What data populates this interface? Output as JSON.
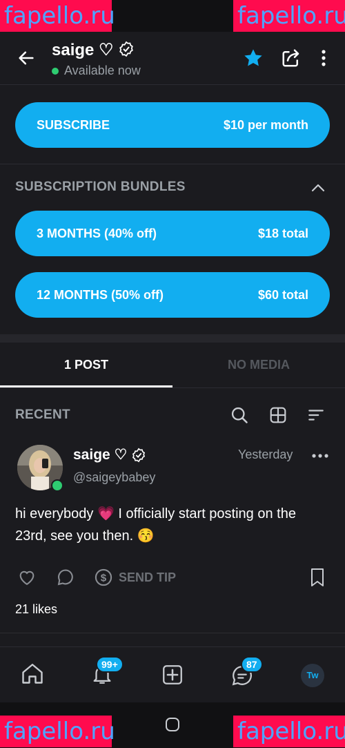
{
  "watermark": "fapello.ru",
  "header": {
    "name": "saige ♡",
    "status": "Available now"
  },
  "subscribe": {
    "label": "SUBSCRIBE",
    "price": "$10 per month"
  },
  "bundles": {
    "title": "SUBSCRIPTION BUNDLES",
    "items": [
      {
        "label": "3 MONTHS (40% off)",
        "price": "$18 total"
      },
      {
        "label": "12 MONTHS (50% off)",
        "price": "$60 total"
      }
    ]
  },
  "tabs": [
    {
      "label": "1 POST",
      "active": true
    },
    {
      "label": "NO MEDIA",
      "active": false
    }
  ],
  "feed": {
    "section": "RECENT"
  },
  "post": {
    "name": "saige ♡",
    "handle": "@saigeybabey",
    "time": "Yesterday",
    "text": "hi everybody 💗 I officially start posting on the 23rd, see you then. 😚",
    "tip_label": "SEND TIP",
    "likes": "21 likes"
  },
  "bottom_nav": {
    "notifications_badge": "99+",
    "messages_badge": "87",
    "avatar_initials": "Tw"
  },
  "colors": {
    "accent": "#12aef0",
    "background": "#1b1b1f",
    "online": "#2ecc71"
  }
}
